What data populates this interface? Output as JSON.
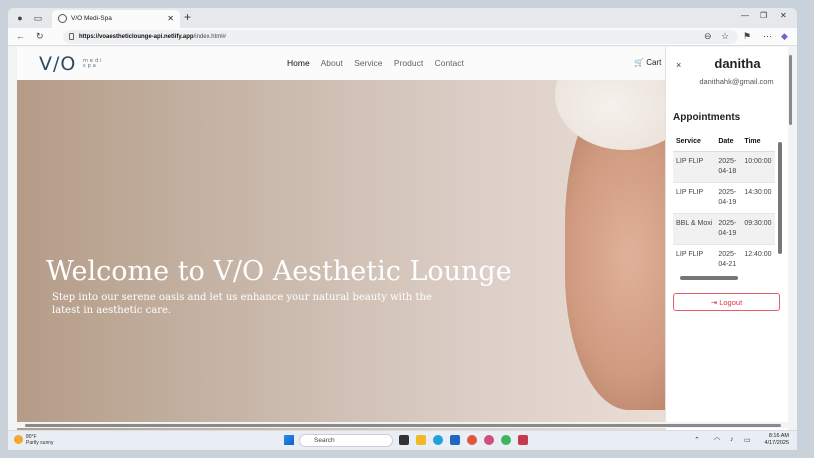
{
  "browser": {
    "tab_title": "V/O Medi-Spa",
    "url_host": "https://voaestheticlounge-api.netlify.app",
    "url_path": "/index.html#"
  },
  "site": {
    "logo_text": "V/O",
    "logo_sub": "medi spa",
    "menu": [
      "Home",
      "About",
      "Service",
      "Product",
      "Contact"
    ],
    "cart_label": "Cart"
  },
  "hero": {
    "title": "Welcome to V/O Aesthetic Lounge",
    "subtitle": "Step into our serene oasis and let us enhance your natural beauty with the latest in aesthetic care."
  },
  "panel": {
    "close": "×",
    "username": "danitha",
    "email": "danithahk@gmail.com",
    "heading": "Appointments",
    "columns": [
      "Service",
      "Date",
      "Time"
    ],
    "rows": [
      [
        "LIP FLIP",
        "2025-04-18",
        "10:00:00"
      ],
      [
        "LIP FLIP",
        "2025-04-19",
        "14:30:00"
      ],
      [
        "BBL & Moxi",
        "2025-04-19",
        "09:30:00"
      ],
      [
        "LIP FLIP",
        "2025-04-21",
        "12:40:00"
      ]
    ],
    "logout": "Logout"
  },
  "taskbar": {
    "temp": "80°F",
    "weather": "Partly sunny",
    "search": "Search",
    "time": "8:16 AM",
    "date": "4/17/2025"
  },
  "colors": {
    "accent": "#2e4a63",
    "logout": "#dc3545"
  }
}
